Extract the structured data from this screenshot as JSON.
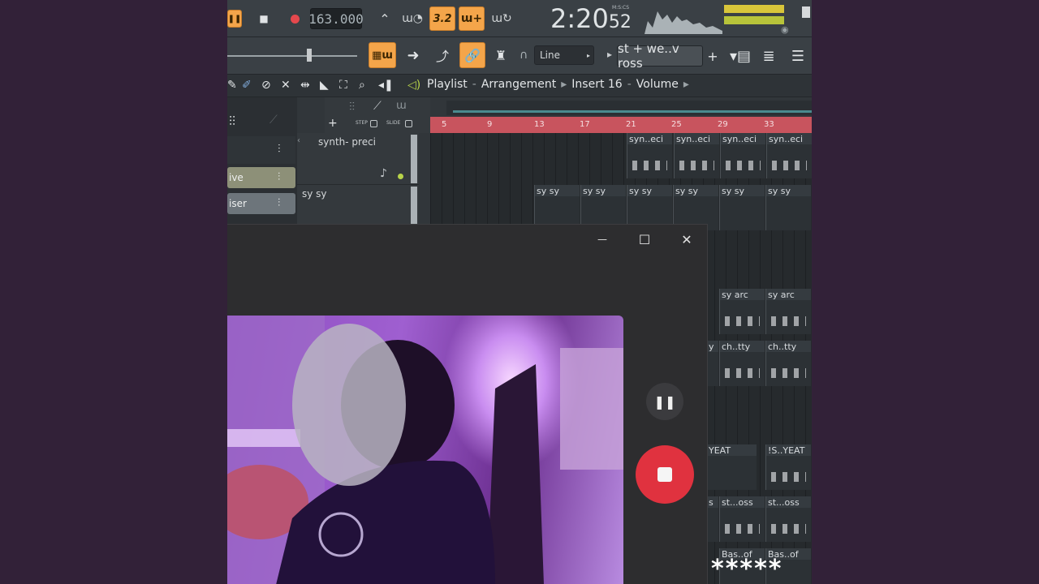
{
  "transport": {
    "tempo": "163.000",
    "pattern": "3.2",
    "time_main": "2:20",
    "time_sub": "52",
    "time_label": "M:S:CS"
  },
  "toolbar2": {
    "snap": "Line",
    "pattern_name": "st + we..v ross",
    "add_label": "+"
  },
  "playlist": {
    "crumbs": [
      "Playlist",
      "Arrangement",
      "Insert 16",
      "Volume"
    ],
    "step_label": "STEP",
    "slide_label": "SLIDE",
    "add_label": "+",
    "bars": [
      "5",
      "9",
      "13",
      "17",
      "21",
      "25",
      "29",
      "33"
    ]
  },
  "tracks": [
    {
      "name": "synth- preci"
    },
    {
      "name": "sy sy"
    }
  ],
  "mini_clips": [
    {
      "label": "ive"
    },
    {
      "label": "iser"
    }
  ],
  "clips": {
    "synth": [
      "syn..eci",
      "syn..eci",
      "syn..eci",
      "syn..eci"
    ],
    "sysy": [
      "sy sy",
      "sy sy",
      "sy sy",
      "sy sy",
      "sy sy",
      "sy sy"
    ],
    "row3": [
      "sy arc",
      "sy arc"
    ],
    "row4": [
      "y",
      "ch..tty",
      "ch..tty"
    ],
    "row5": [
      "YEAT",
      "!S..YEAT"
    ],
    "row6": [
      "s",
      "st...oss",
      "st...oss"
    ],
    "row7": [
      "Bas..of",
      "Bas..of"
    ]
  },
  "overlay": {
    "minimize": "—",
    "maximize": "☐",
    "close": "✕"
  },
  "rating": "*****"
}
